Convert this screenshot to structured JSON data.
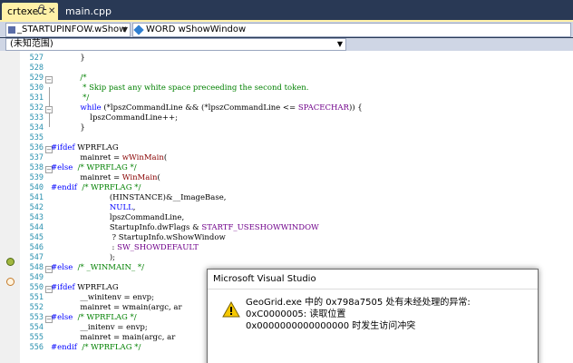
{
  "tabs": [
    {
      "label": "crtexe.c",
      "active": true
    },
    {
      "label": "main.cpp",
      "active": false
    }
  ],
  "navbar": {
    "type_combo": "_STARTUPINFOW.wShow",
    "member_combo": "WORD wShowWindow",
    "scope_combo": "(未知范围)"
  },
  "code_lines": [
    {
      "num": "527",
      "text": "            }"
    },
    {
      "num": "528",
      "text": ""
    },
    {
      "num": "529",
      "text": "            /*"
    },
    {
      "num": "530",
      "text": "             * Skip past any white space preceeding the second token."
    },
    {
      "num": "531",
      "text": "             */"
    },
    {
      "num": "532",
      "text": "            while (*lpszCommandLine && (*lpszCommandLine <= SPACECHAR)) {"
    },
    {
      "num": "533",
      "text": "                lpszCommandLine++;"
    },
    {
      "num": "534",
      "text": "            }"
    },
    {
      "num": "535",
      "text": ""
    },
    {
      "num": "536",
      "text": "#ifdef WPRFLAG"
    },
    {
      "num": "537",
      "text": "            mainret = wWinMain("
    },
    {
      "num": "538",
      "text": "#else  /* WPRFLAG */"
    },
    {
      "num": "539",
      "text": "            mainret = WinMain("
    },
    {
      "num": "540",
      "text": "#endif  /* WPRFLAG */"
    },
    {
      "num": "541",
      "text": "                        (HINSTANCE)&__ImageBase,"
    },
    {
      "num": "542",
      "text": "                        NULL,"
    },
    {
      "num": "543",
      "text": "                        lpszCommandLine,"
    },
    {
      "num": "544",
      "text": "                        StartupInfo.dwFlags & STARTF_USESHOWWINDOW"
    },
    {
      "num": "545",
      "text": "                         ? StartupInfo.wShowWindow"
    },
    {
      "num": "546",
      "text": "                         : SW_SHOWDEFAULT"
    },
    {
      "num": "547",
      "text": "                        );"
    },
    {
      "num": "548",
      "text": "#else  /* _WINMAIN_ */"
    },
    {
      "num": "549",
      "text": ""
    },
    {
      "num": "550",
      "text": "#ifdef WPRFLAG"
    },
    {
      "num": "551",
      "text": "            __winitenv = envp;"
    },
    {
      "num": "552",
      "text": "            mainret = wmain(argc, ar"
    },
    {
      "num": "553",
      "text": "#else  /* WPRFLAG */"
    },
    {
      "num": "554",
      "text": "            __initenv = envp;"
    },
    {
      "num": "555",
      "text": "            mainret = main(argc, ar"
    },
    {
      "num": "556",
      "text": "#endif  /* WPRFLAG */"
    }
  ],
  "dialog": {
    "title": "Microsoft Visual Studio",
    "message_line1": "GeoGrid.exe 中的 0x798a7505 处有未经处理的异常: 0xC0000005: 读取位置",
    "message_line2": "0x0000000000000000 时发生访问冲突"
  },
  "icons": {
    "warning": "warning-icon",
    "breakpoint": "current-statement-icon",
    "callstack": "call-stack-frame-icon"
  },
  "colors": {
    "tab_active": "#fff1a8",
    "chrome_dark": "#293955",
    "keyword": "#0000ff",
    "comment": "#008000",
    "macro": "#6f008a",
    "line_number": "#2b91af"
  }
}
